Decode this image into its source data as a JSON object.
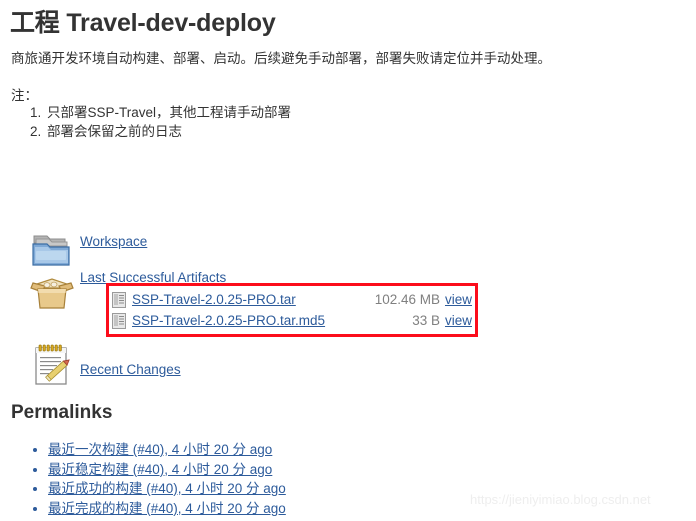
{
  "page": {
    "title": "工程 Travel-dev-deploy",
    "description": "商旅通开发环境自动构建、部署、启动。后续避免手动部署，部署失败请定位并手动处理。",
    "note_label": "注：",
    "notes": [
      {
        "num": "1.",
        "text": "只部署SSP-Travel，其他工程请手动部署"
      },
      {
        "num": "2.",
        "text": "部署会保留之前的日志"
      }
    ]
  },
  "rows": {
    "workspace": {
      "label": "Workspace",
      "icon": "folder-icon"
    },
    "artifacts": {
      "label": "Last Successful Artifacts",
      "icon": "package-icon"
    },
    "changes": {
      "label": "Recent Changes",
      "icon": "notepad-pencil-icon"
    }
  },
  "artifacts": {
    "view_label": "view",
    "files": [
      {
        "name": "SSP-Travel-2.0.25-PRO.tar",
        "size": "102.46 MB",
        "view": "view"
      },
      {
        "name": "SSP-Travel-2.0.25-PRO.tar.md5",
        "size": "33 B",
        "view": "view"
      }
    ]
  },
  "permalinks": {
    "heading": "Permalinks",
    "items": [
      {
        "text": "最近一次构建 (#40), 4 小时 20 分 ago"
      },
      {
        "text": "最近稳定构建 (#40), 4 小时 20 分 ago"
      },
      {
        "text": "最近成功的构建 (#40), 4 小时 20 分 ago"
      },
      {
        "text": "最近完成的构建 (#40), 4 小时 20 分 ago"
      }
    ]
  },
  "watermark": {
    "text": "https://jieniyimiao.blog.csdn.net"
  },
  "colors": {
    "link": "#2d5b9b",
    "text": "#333333",
    "size_text": "#808080",
    "highlight_box": "#fc0d1b",
    "background": "#ffffff"
  }
}
